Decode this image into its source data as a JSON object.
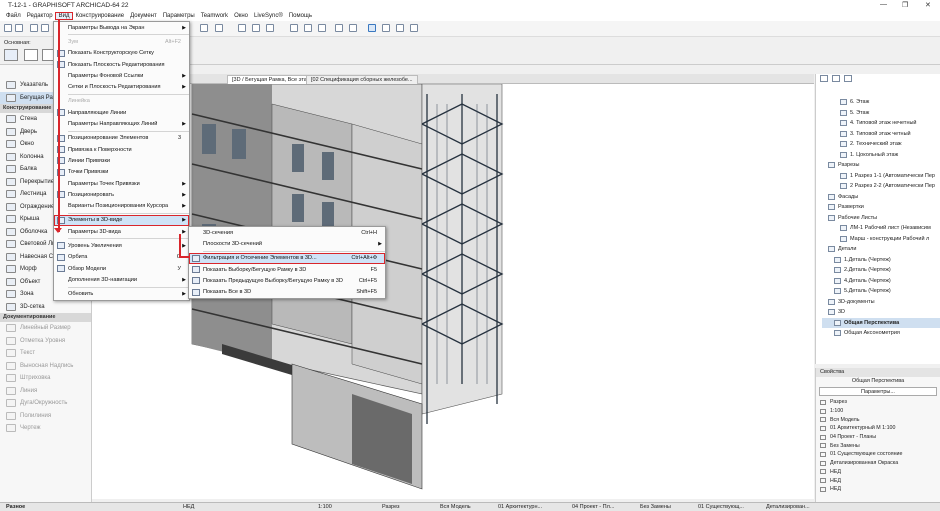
{
  "title": "T-12-1 - GRAPHISOFT ARCHICAD-64 22",
  "menubar": [
    "Файл",
    "Редактор",
    "Вид",
    "Конструирование",
    "Документ",
    "Параметры",
    "Teamwork",
    "Окно",
    "LiveSync®",
    "Помощь"
  ],
  "infobar": {
    "label": "Основная:"
  },
  "toolbox": {
    "top_items": [
      "Указатель",
      "Бегущая Рамка"
    ],
    "section_construct": "Конструирование",
    "construct_items": [
      "Стена",
      "Дверь",
      "Окно",
      "Колонна",
      "Балка",
      "Перекрытие",
      "Лестница",
      "Ограждение",
      "Крыша",
      "Оболочка",
      "Световой Люк",
      "Навесная Стена",
      "Морф",
      "Объект",
      "Зона",
      "3D-сетка"
    ],
    "section_doc": "Документирование",
    "doc_items": [
      "Линейный Размер",
      "Отметка Уровня",
      "Текст",
      "Выносная Надпись",
      "Штриховка",
      "Линия",
      "Дуга/Окружность",
      "Полилиния",
      "Чертеж"
    ],
    "bottom": "Разное"
  },
  "tabs": [
    "[3D / Бегущая Рамка, Все этажи]",
    "[02 Спецификация сборных железобе..."
  ],
  "menu_view": [
    {
      "label": "Параметры Вывода на Экран",
      "arrow": true
    },
    {
      "label": "Зум",
      "shortcut": "Alt+F2",
      "disabled": true
    },
    {
      "label": "Показать Конструкторскую Сетку"
    },
    {
      "label": "Показать Плоскость Редактирования"
    },
    {
      "label": "Параметры Фоновой Ссылки",
      "arrow": true
    },
    {
      "label": "Сетки и Плоскость Редактирования",
      "arrow": true
    },
    {
      "label": "Линейка",
      "disabled": true
    },
    {
      "label": "Направляющие Линии"
    },
    {
      "label": "Параметры Направляющих Линий",
      "arrow": true
    },
    {
      "label": "Позиционирование Элементов",
      "shortcut": "3"
    },
    {
      "label": "Привязка к Поверхности"
    },
    {
      "label": "Линии Привязки"
    },
    {
      "label": "Точки Привязки"
    },
    {
      "label": "Параметры Точек Привязки",
      "arrow": true
    },
    {
      "label": "Позиционировать",
      "arrow": true
    },
    {
      "label": "Варианты Позиционирования Курсора",
      "arrow": true
    },
    {
      "label": "Элементы в 3D-виде",
      "arrow": true,
      "highlight": true
    },
    {
      "label": "Параметры 3D-вида",
      "arrow": true
    },
    {
      "label": "Уровень Увеличения",
      "arrow": true
    },
    {
      "label": "Орбита",
      "shortcut": "O"
    },
    {
      "label": "Обзор Модели",
      "shortcut": "У"
    },
    {
      "label": "Дополнения 3D-навигации",
      "arrow": true
    },
    {
      "label": "Обновить",
      "arrow": true
    }
  ],
  "submenu": [
    {
      "label": "3D-сечения",
      "shortcut": "Ctrl+H"
    },
    {
      "label": "Плоскости 3D-сечений",
      "arrow": true
    },
    {
      "label": "Фильтрация и Отсечение Элементов в 3D...",
      "shortcut": "Ctrl+Alt+Ф",
      "highlight": true
    },
    {
      "label": "Показать Выборку/Бегущую Рамку в 3D",
      "shortcut": "F5"
    },
    {
      "label": "Показать Предыдущую Выборку/Бегущую Рамку в 3D",
      "shortcut": "Ctrl+F5"
    },
    {
      "label": "Показать Все в 3D",
      "shortcut": "Shift+F5"
    }
  ],
  "navigator": [
    {
      "label": "6. Этаж"
    },
    {
      "label": "5. Этаж"
    },
    {
      "label": "4. Типовой этаж нечетный"
    },
    {
      "label": "3. Типовой этаж четный"
    },
    {
      "label": "2. Технический этаж"
    },
    {
      "label": "1. Цокольный этаж"
    },
    {
      "label": "Разрезы"
    },
    {
      "label": "1 Разрез 1-1 (Автоматически Пер"
    },
    {
      "label": "2 Разрез 2-2 (Автоматически Пер"
    },
    {
      "label": "Фасады"
    },
    {
      "label": "Развертки"
    },
    {
      "label": "Рабочие Листы"
    },
    {
      "label": "ЛМ-1 Рабочий лист (Независим"
    },
    {
      "label": "Марш - конструкции Рабочий л"
    },
    {
      "label": "Детали"
    },
    {
      "label": "1.Деталь (Чертеж)"
    },
    {
      "label": "2.Деталь (Чертеж)"
    },
    {
      "label": "4.Деталь (Чертеж)"
    },
    {
      "label": "5.Деталь (Чертеж)"
    },
    {
      "label": "3D-документы"
    },
    {
      "label": "3D"
    },
    {
      "label": "Общая Перспектива",
      "selected": true
    },
    {
      "label": "Общая Аксонометрия"
    }
  ],
  "props": {
    "header": "Свойства",
    "view_name": "Общая Перспектива",
    "params_button": "Параметры...",
    "rows": [
      "Разрез",
      "1:100",
      "Вся Модель",
      "01 Архитектурный М 1:100",
      "04 Проект - Планы",
      "Без Замены",
      "01 Существующее состояние",
      "Детализированная Окраска",
      "НЕД",
      "НЕД",
      "НЕД"
    ]
  },
  "status": {
    "hint": "НЕД",
    "scale": "1:100",
    "cut": "Разрез",
    "model": "Вся Модель",
    "layer": "01 Архитектурн...",
    "plan": "04 Проект - Пл...",
    "override": "Без Замены",
    "renovation": "01 Существующ...",
    "detail": "Детализирован..."
  }
}
